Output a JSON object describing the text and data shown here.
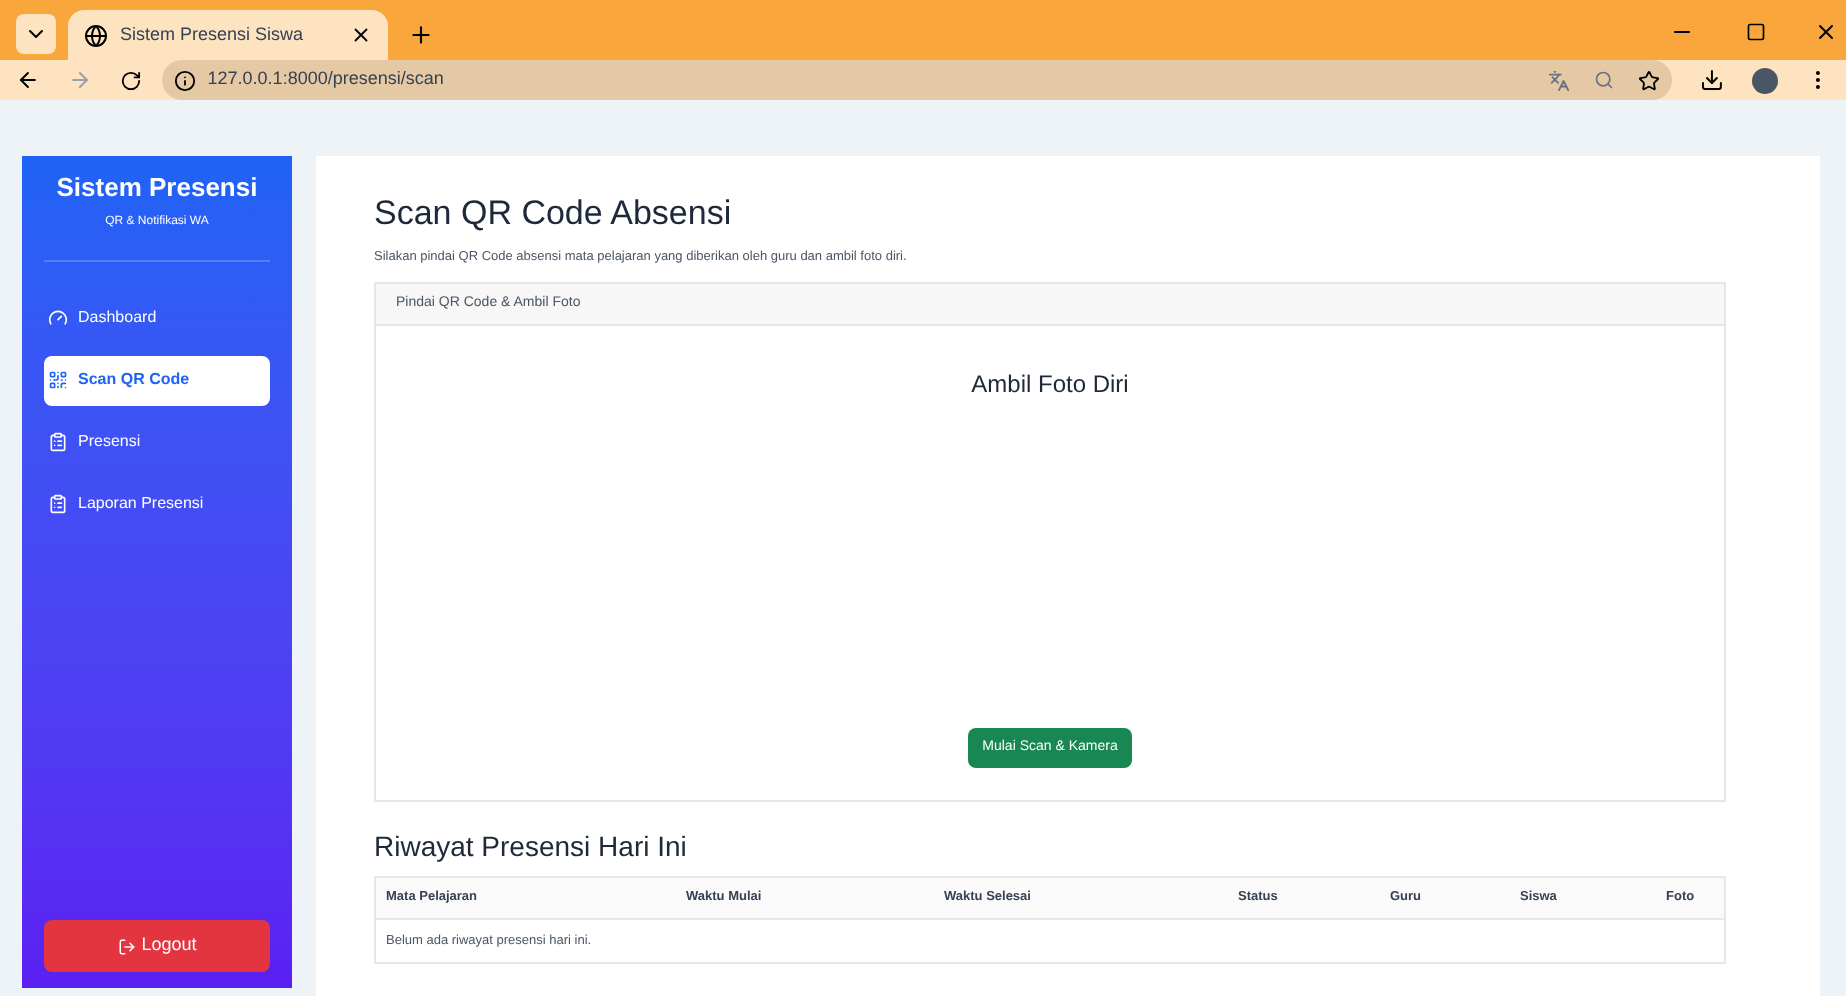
{
  "browser": {
    "tab_title": "Sistem Presensi Siswa",
    "url": "127.0.0.1:8000/presensi/scan"
  },
  "sidebar": {
    "title": "Sistem Presensi",
    "subtitle": "QR & Notifikasi WA",
    "items": [
      {
        "label": "Dashboard",
        "selected": false
      },
      {
        "label": "Scan QR Code",
        "selected": true
      },
      {
        "label": "Presensi",
        "selected": false
      },
      {
        "label": "Laporan Presensi",
        "selected": false
      }
    ],
    "logout": "Logout"
  },
  "page": {
    "title": "Scan QR Code Absensi",
    "description": "Silakan pindai QR Code absensi mata pelajaran yang diberikan oleh guru dan ambil foto diri."
  },
  "scan_card": {
    "header": "Pindai QR Code & Ambil Foto",
    "heading": "Ambil Foto Diri",
    "button": "Mulai Scan & Kamera"
  },
  "history": {
    "title": "Riwayat Presensi Hari Ini",
    "columns": [
      "Mata Pelajaran",
      "Waktu Mulai",
      "Waktu Selesai",
      "Status",
      "Guru",
      "Siswa",
      "Foto"
    ],
    "empty": "Belum ada riwayat presensi hari ini."
  }
}
